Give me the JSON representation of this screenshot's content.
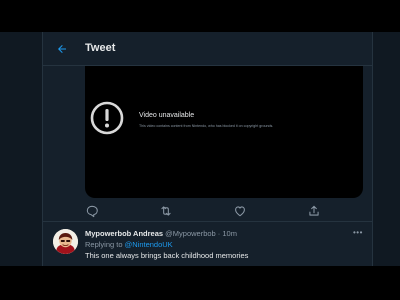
{
  "header": {
    "title": "Tweet"
  },
  "video": {
    "title": "Video unavailable",
    "message": "This video contains content from Nintendo, who has blocked it on copyright grounds."
  },
  "reply_tweet": {
    "author_name": "Mypowerbob Andreas",
    "meta": "@Mypowerbob · 10m",
    "replying_label": "Replying to",
    "replying_handle": "@NintendoUK",
    "text": "This one always brings back childhood memories"
  },
  "icons": {
    "back": "arrow-left-icon",
    "reply": "reply-icon",
    "retweet": "retweet-icon",
    "like": "heart-icon",
    "share": "share-icon",
    "more": "more-icon",
    "unavailable": "exclamation-circle-icon"
  },
  "colors": {
    "background": "#15202b",
    "accent": "#1d9bf0",
    "text": "#e7e9ea",
    "muted": "#8b98a5"
  }
}
